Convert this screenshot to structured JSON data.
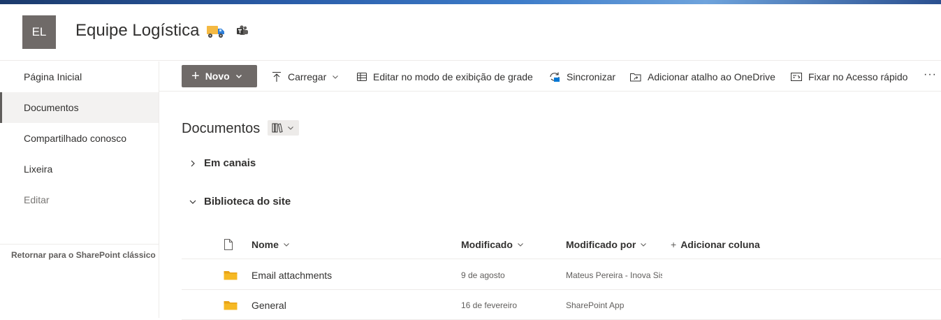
{
  "site": {
    "logo_initials": "EL",
    "title": "Equipe Logística",
    "title_icon": "truck-emoji",
    "teams_icon": "teams-icon"
  },
  "nav": {
    "items": [
      {
        "label": "Página Inicial"
      },
      {
        "label": "Documentos",
        "selected": true
      },
      {
        "label": "Compartilhado conosco"
      },
      {
        "label": "Lixeira"
      },
      {
        "label": "Editar"
      }
    ],
    "classic_link": "Retornar para o SharePoint clássico"
  },
  "commands": {
    "new": "Novo",
    "upload": "Carregar",
    "grid_edit": "Editar no modo de exibição de grade",
    "sync": "Sincronizar",
    "onedrive_shortcut": "Adicionar atalho ao OneDrive",
    "pin_quick_access": "Fixar no Acesso rápido",
    "more": "···"
  },
  "library": {
    "title": "Documentos",
    "groups": [
      {
        "label": "Em canais",
        "expanded": false
      },
      {
        "label": "Biblioteca do site",
        "expanded": true
      }
    ],
    "columns": {
      "name": "Nome",
      "modified": "Modificado",
      "modified_by": "Modificado por",
      "add_column": "Adicionar coluna"
    },
    "rows": [
      {
        "name": "Email attachments",
        "modified": "9 de agosto",
        "modified_by": "Mateus Pereira - Inova Sistemas"
      },
      {
        "name": "General",
        "modified": "16 de fevereiro",
        "modified_by": "SharePoint App"
      }
    ]
  },
  "colors": {
    "accent": "#6f6a68",
    "folder": "#f6b924",
    "banner": "#2a5ca8"
  }
}
